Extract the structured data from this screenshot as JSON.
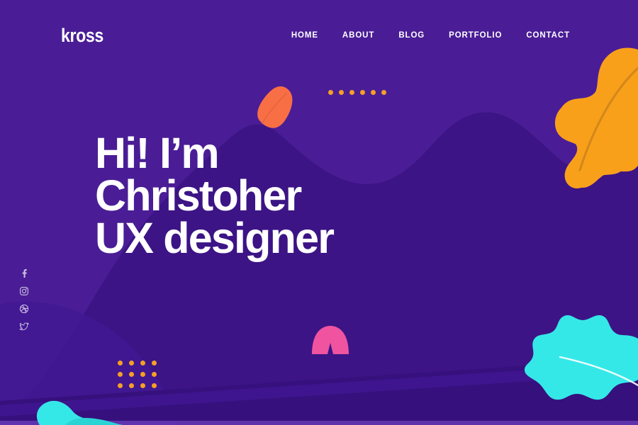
{
  "brand": {
    "name": "kross"
  },
  "nav": {
    "items": [
      {
        "label": "HOME"
      },
      {
        "label": "ABOUT"
      },
      {
        "label": "BLOG"
      },
      {
        "label": "PORTFOLIO"
      },
      {
        "label": "CONTACT"
      }
    ]
  },
  "hero": {
    "line1": "Hi! I’m",
    "line2": "Christoher",
    "line3": "UX designer"
  },
  "social": {
    "items": [
      {
        "icon": "facebook-icon",
        "label": "Facebook"
      },
      {
        "icon": "instagram-icon",
        "label": "Instagram"
      },
      {
        "icon": "dribbble-icon",
        "label": "Dribbble"
      },
      {
        "icon": "twitter-icon",
        "label": "Twitter"
      }
    ]
  },
  "decorations": {
    "orange_leaf": "orange-oak-leaf",
    "cyan_leaf": "cyan-oak-leaf",
    "coral_pod": "coral-seed-pod",
    "pink_dome": "pink-dome-shape",
    "cyan_blob": "cyan-blob-shape",
    "dot_row": {
      "name": "orange-dot-row",
      "count": 6
    },
    "dot_grid": {
      "name": "orange-dot-grid",
      "columns": 4,
      "rows": 3,
      "count": 12
    }
  },
  "colors": {
    "background": "#4a1d96",
    "blob_dark": "#3c1485",
    "band_dark": "#36107c",
    "band_light": "#5226a6",
    "orange": "#f9a01b",
    "orange_vein": "#d4881a",
    "coral": "#f96f45",
    "coral_vein": "#e4653f",
    "pink": "#f0539f",
    "cyan": "#35e8e8",
    "dot": "#f5a024",
    "text": "#ffffff"
  }
}
